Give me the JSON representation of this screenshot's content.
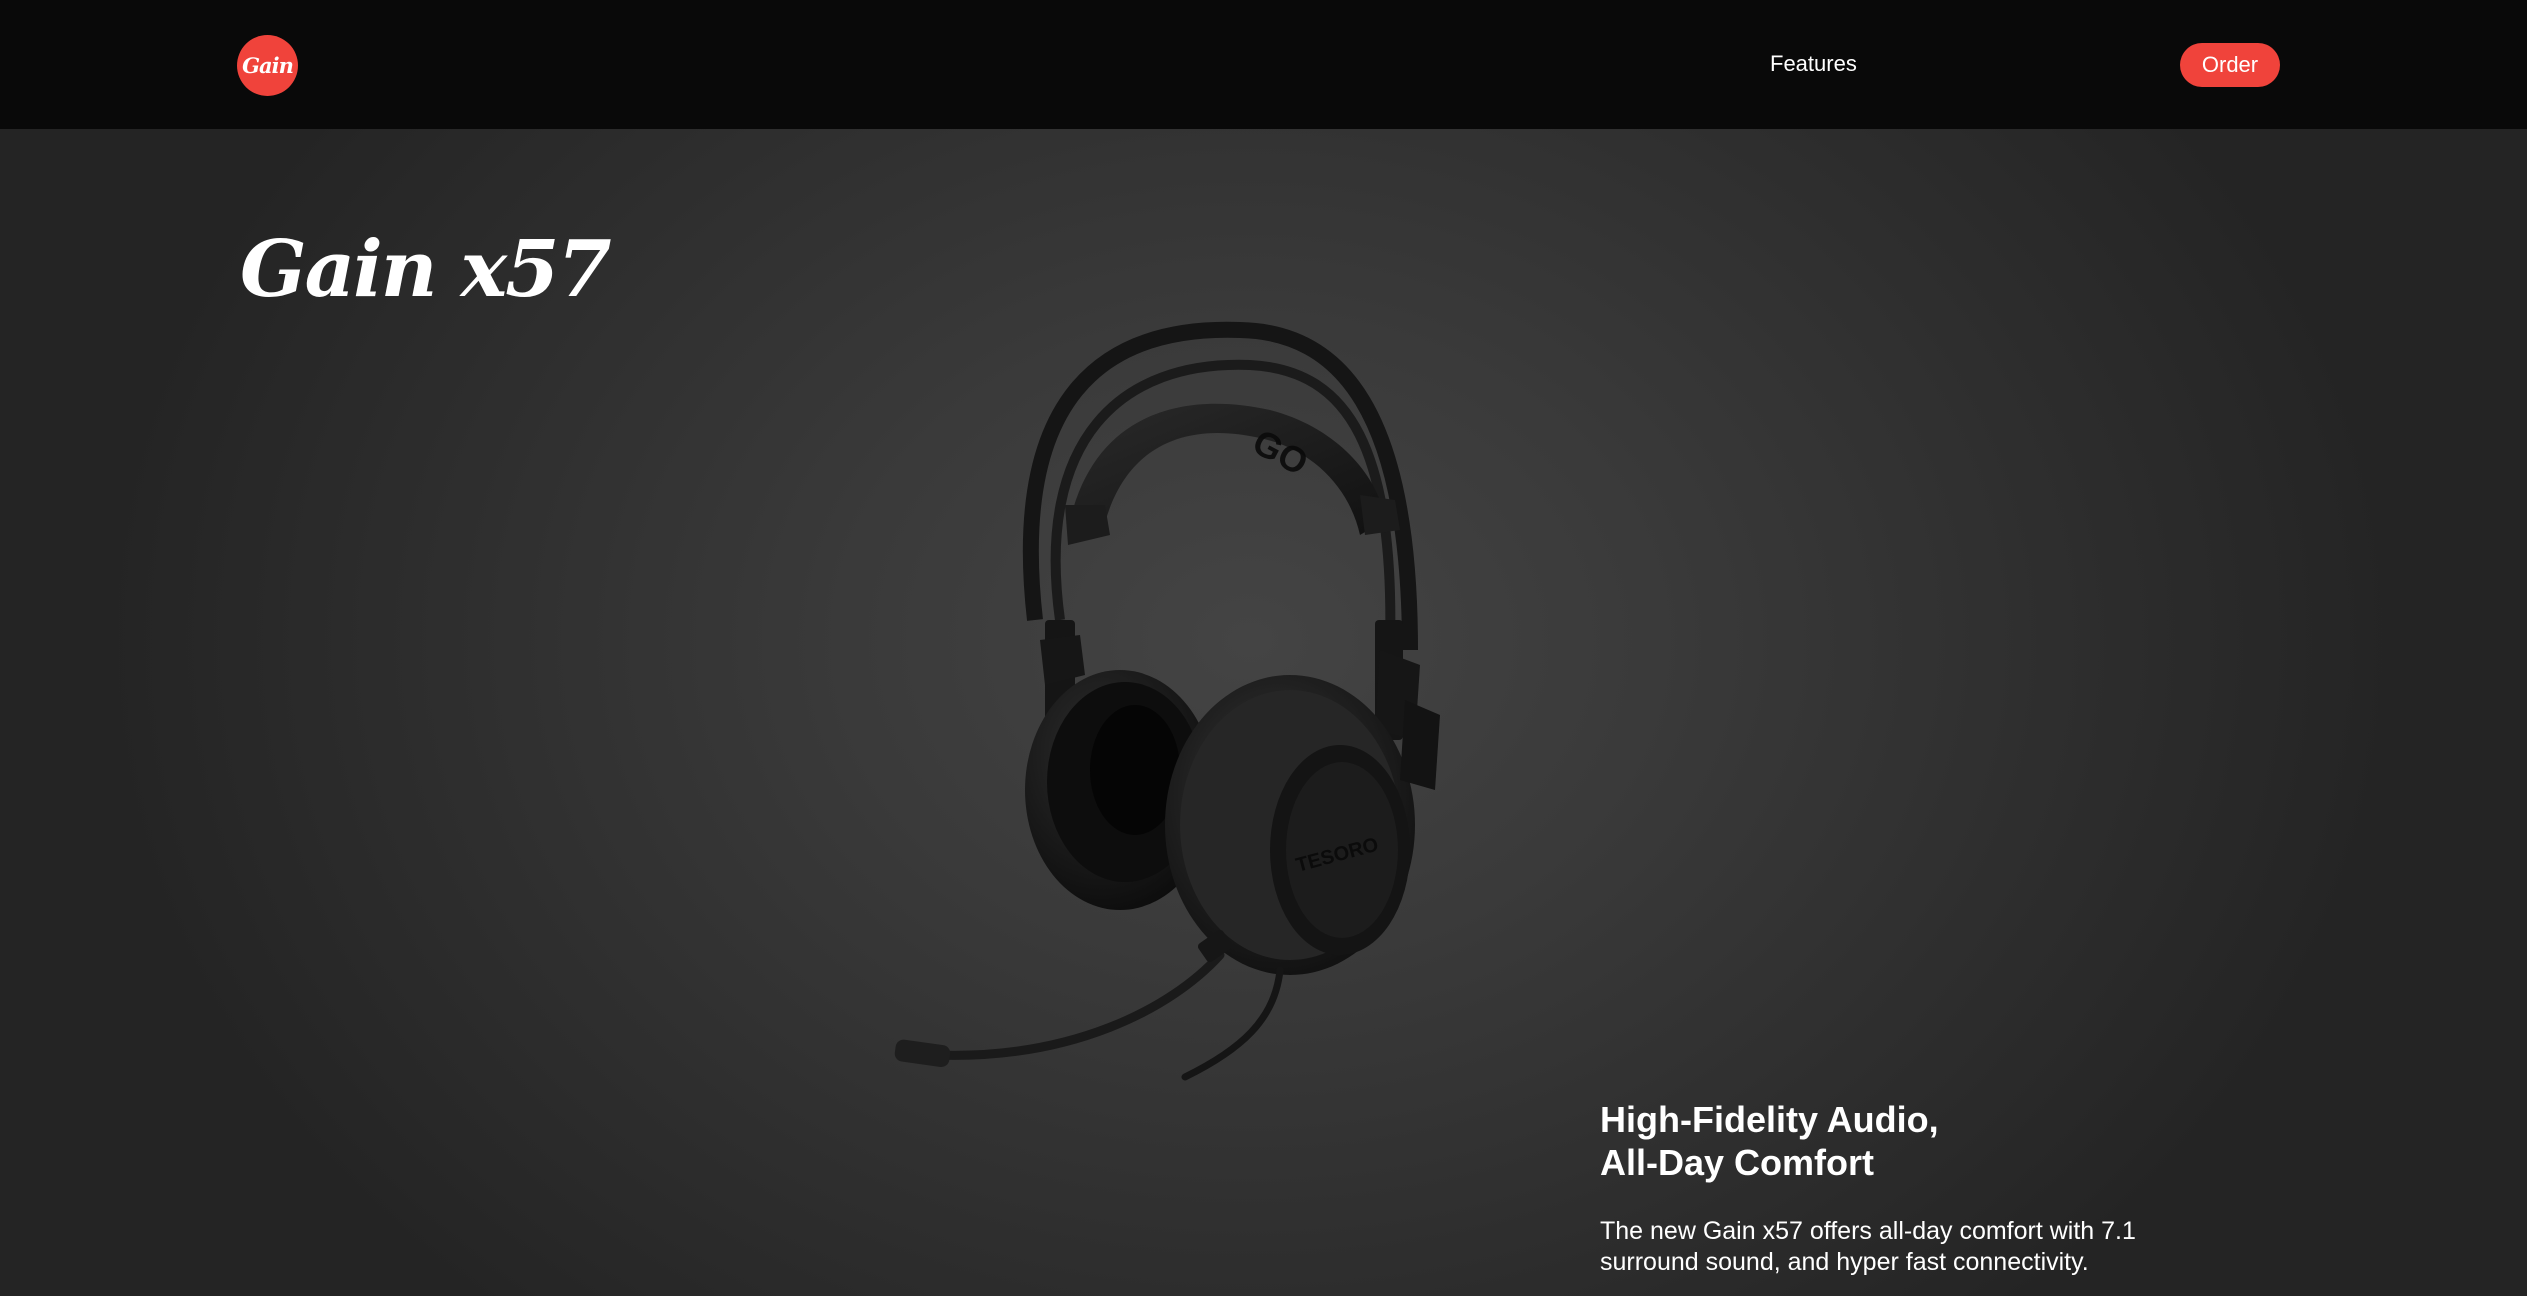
{
  "navbar": {
    "logo_text": "Gain",
    "links": [
      {
        "label": "Features"
      }
    ],
    "order_label": "Order",
    "accent_color": "#f0433b"
  },
  "hero": {
    "title": "Gain x57",
    "product_image": {
      "icon": "headset",
      "brand_mark": "TESORO"
    }
  },
  "feature": {
    "heading_line1": "High-Fidelity Audio,",
    "heading_line2": "All-Day Comfort",
    "description": "The new Gain x57 offers all-day comfort with 7.1 surround sound, and hyper fast connectivity."
  }
}
